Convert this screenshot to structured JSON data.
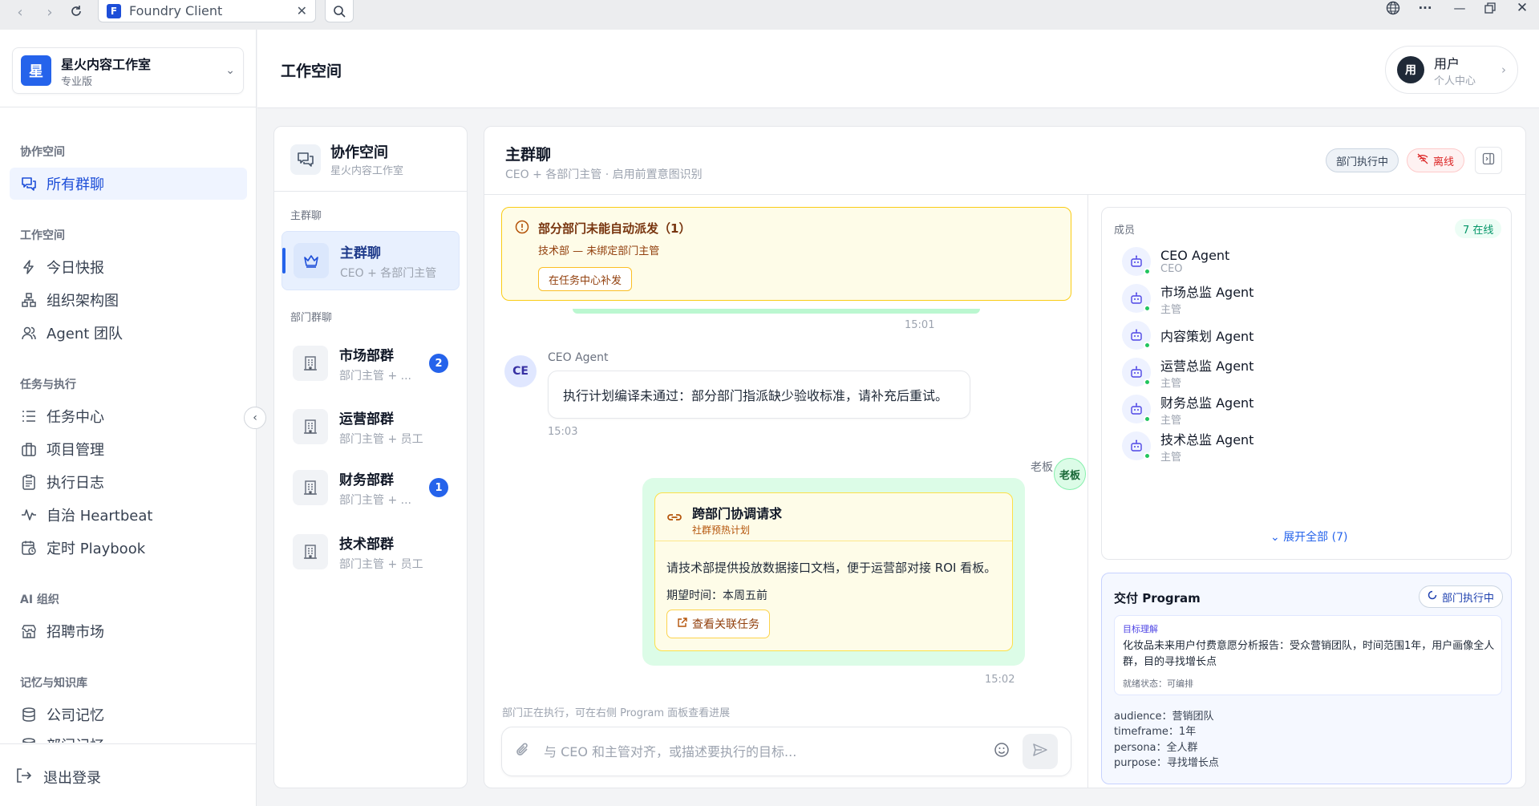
{
  "browser": {
    "tab_title": "Foundry Client",
    "tab_logo": "F"
  },
  "org": {
    "logo": "星",
    "name": "星火内容工作室",
    "plan": "专业版"
  },
  "sidebar": {
    "sections": [
      {
        "label": "协作空间",
        "items": [
          {
            "label": "所有群聊",
            "icon": "chat-icon",
            "active": true
          }
        ]
      },
      {
        "label": "工作空间",
        "items": [
          {
            "label": "今日快报",
            "icon": "bolt-icon"
          },
          {
            "label": "组织架构图",
            "icon": "org-chart-icon"
          },
          {
            "label": "Agent 团队",
            "icon": "users-icon"
          }
        ]
      },
      {
        "label": "任务与执行",
        "items": [
          {
            "label": "任务中心",
            "icon": "list-icon"
          },
          {
            "label": "项目管理",
            "icon": "briefcase-icon"
          },
          {
            "label": "执行日志",
            "icon": "clipboard-icon"
          },
          {
            "label": "自治 Heartbeat",
            "icon": "pulse-icon"
          },
          {
            "label": "定时 Playbook",
            "icon": "calendar-clock-icon"
          }
        ]
      },
      {
        "label": "AI 组织",
        "items": [
          {
            "label": "招聘市场",
            "icon": "store-icon"
          }
        ]
      },
      {
        "label": "记忆与知识库",
        "items": [
          {
            "label": "公司记忆",
            "icon": "database-icon"
          },
          {
            "label": "部门记忆",
            "icon": "database-icon"
          }
        ]
      }
    ],
    "logout": "退出登录"
  },
  "header": {
    "title": "工作空间",
    "user": {
      "avatar": "用",
      "name": "用户",
      "sub": "个人中心"
    }
  },
  "conv_panel": {
    "title": "协作空间",
    "subtitle": "星火内容工作室",
    "main_label": "主群聊",
    "dept_label": "部门群聊",
    "main_conv": {
      "name": "主群聊",
      "sub": "CEO + 各部门主管"
    },
    "dept_convs": [
      {
        "name": "市场部群",
        "sub": "部门主管 + ...",
        "badge": "2"
      },
      {
        "name": "运营部群",
        "sub": "部门主管 + 员工",
        "badge": ""
      },
      {
        "name": "财务部群",
        "sub": "部门主管 + ...",
        "badge": "1"
      },
      {
        "name": "技术部群",
        "sub": "部门主管 + 员工",
        "badge": ""
      }
    ]
  },
  "chat": {
    "title": "主群聊",
    "subtitle": "CEO + 各部门主管 · 启用前置意图识别",
    "status_exec": "部门执行中",
    "status_offline": "离线",
    "alert": {
      "title": "部分部门未能自动派发（1）",
      "detail": "技术部 — 未绑定部门主管",
      "action": "在任务中心补发"
    },
    "time1": "15:01",
    "msg_in": {
      "avatar": "CE",
      "sender": "CEO Agent",
      "text": "执行计划编译未通过：部分部门指派缺少验收标准，请补充后重试。",
      "time": "15:03"
    },
    "msg_out": {
      "sender": "老板",
      "avatar": "老板",
      "card_title": "跨部门协调请求",
      "card_sub": "社群预热计划",
      "card_body": "请技术部提供投放数据接口文档，便于运营部对接 ROI 看板。",
      "card_time": "期望时间：本周五前",
      "card_button": "查看关联任务",
      "time": "15:02"
    },
    "hint": "部门正在执行，可在右侧 Program 面板查看进展",
    "composer_placeholder": "与 CEO 和主管对齐，或描述要执行的目标..."
  },
  "members": {
    "title": "成员",
    "online": "7 在线",
    "list": [
      {
        "name": "CEO Agent",
        "role": "CEO"
      },
      {
        "name": "市场总监 Agent",
        "role": "主管"
      },
      {
        "name": "内容策划 Agent",
        "role": ""
      },
      {
        "name": "运营总监 Agent",
        "role": "主管"
      },
      {
        "name": "财务总监 Agent",
        "role": "主管"
      },
      {
        "name": "技术总监 Agent",
        "role": "主管"
      }
    ],
    "expand": "展开全部 (7)"
  },
  "program": {
    "title": "交付 Program",
    "status": "部门执行中",
    "goal_label": "目标理解",
    "goal_text": "化妆品未来用户付费意愿分析报告：受众营销团队，时间范围1年，用户画像全人群，目的寻找增长点",
    "goal_status": "就绪状态：可编排",
    "params": [
      "audience：营销团队",
      "timeframe：1年",
      "persona：全人群",
      "purpose：寻找增长点"
    ]
  }
}
